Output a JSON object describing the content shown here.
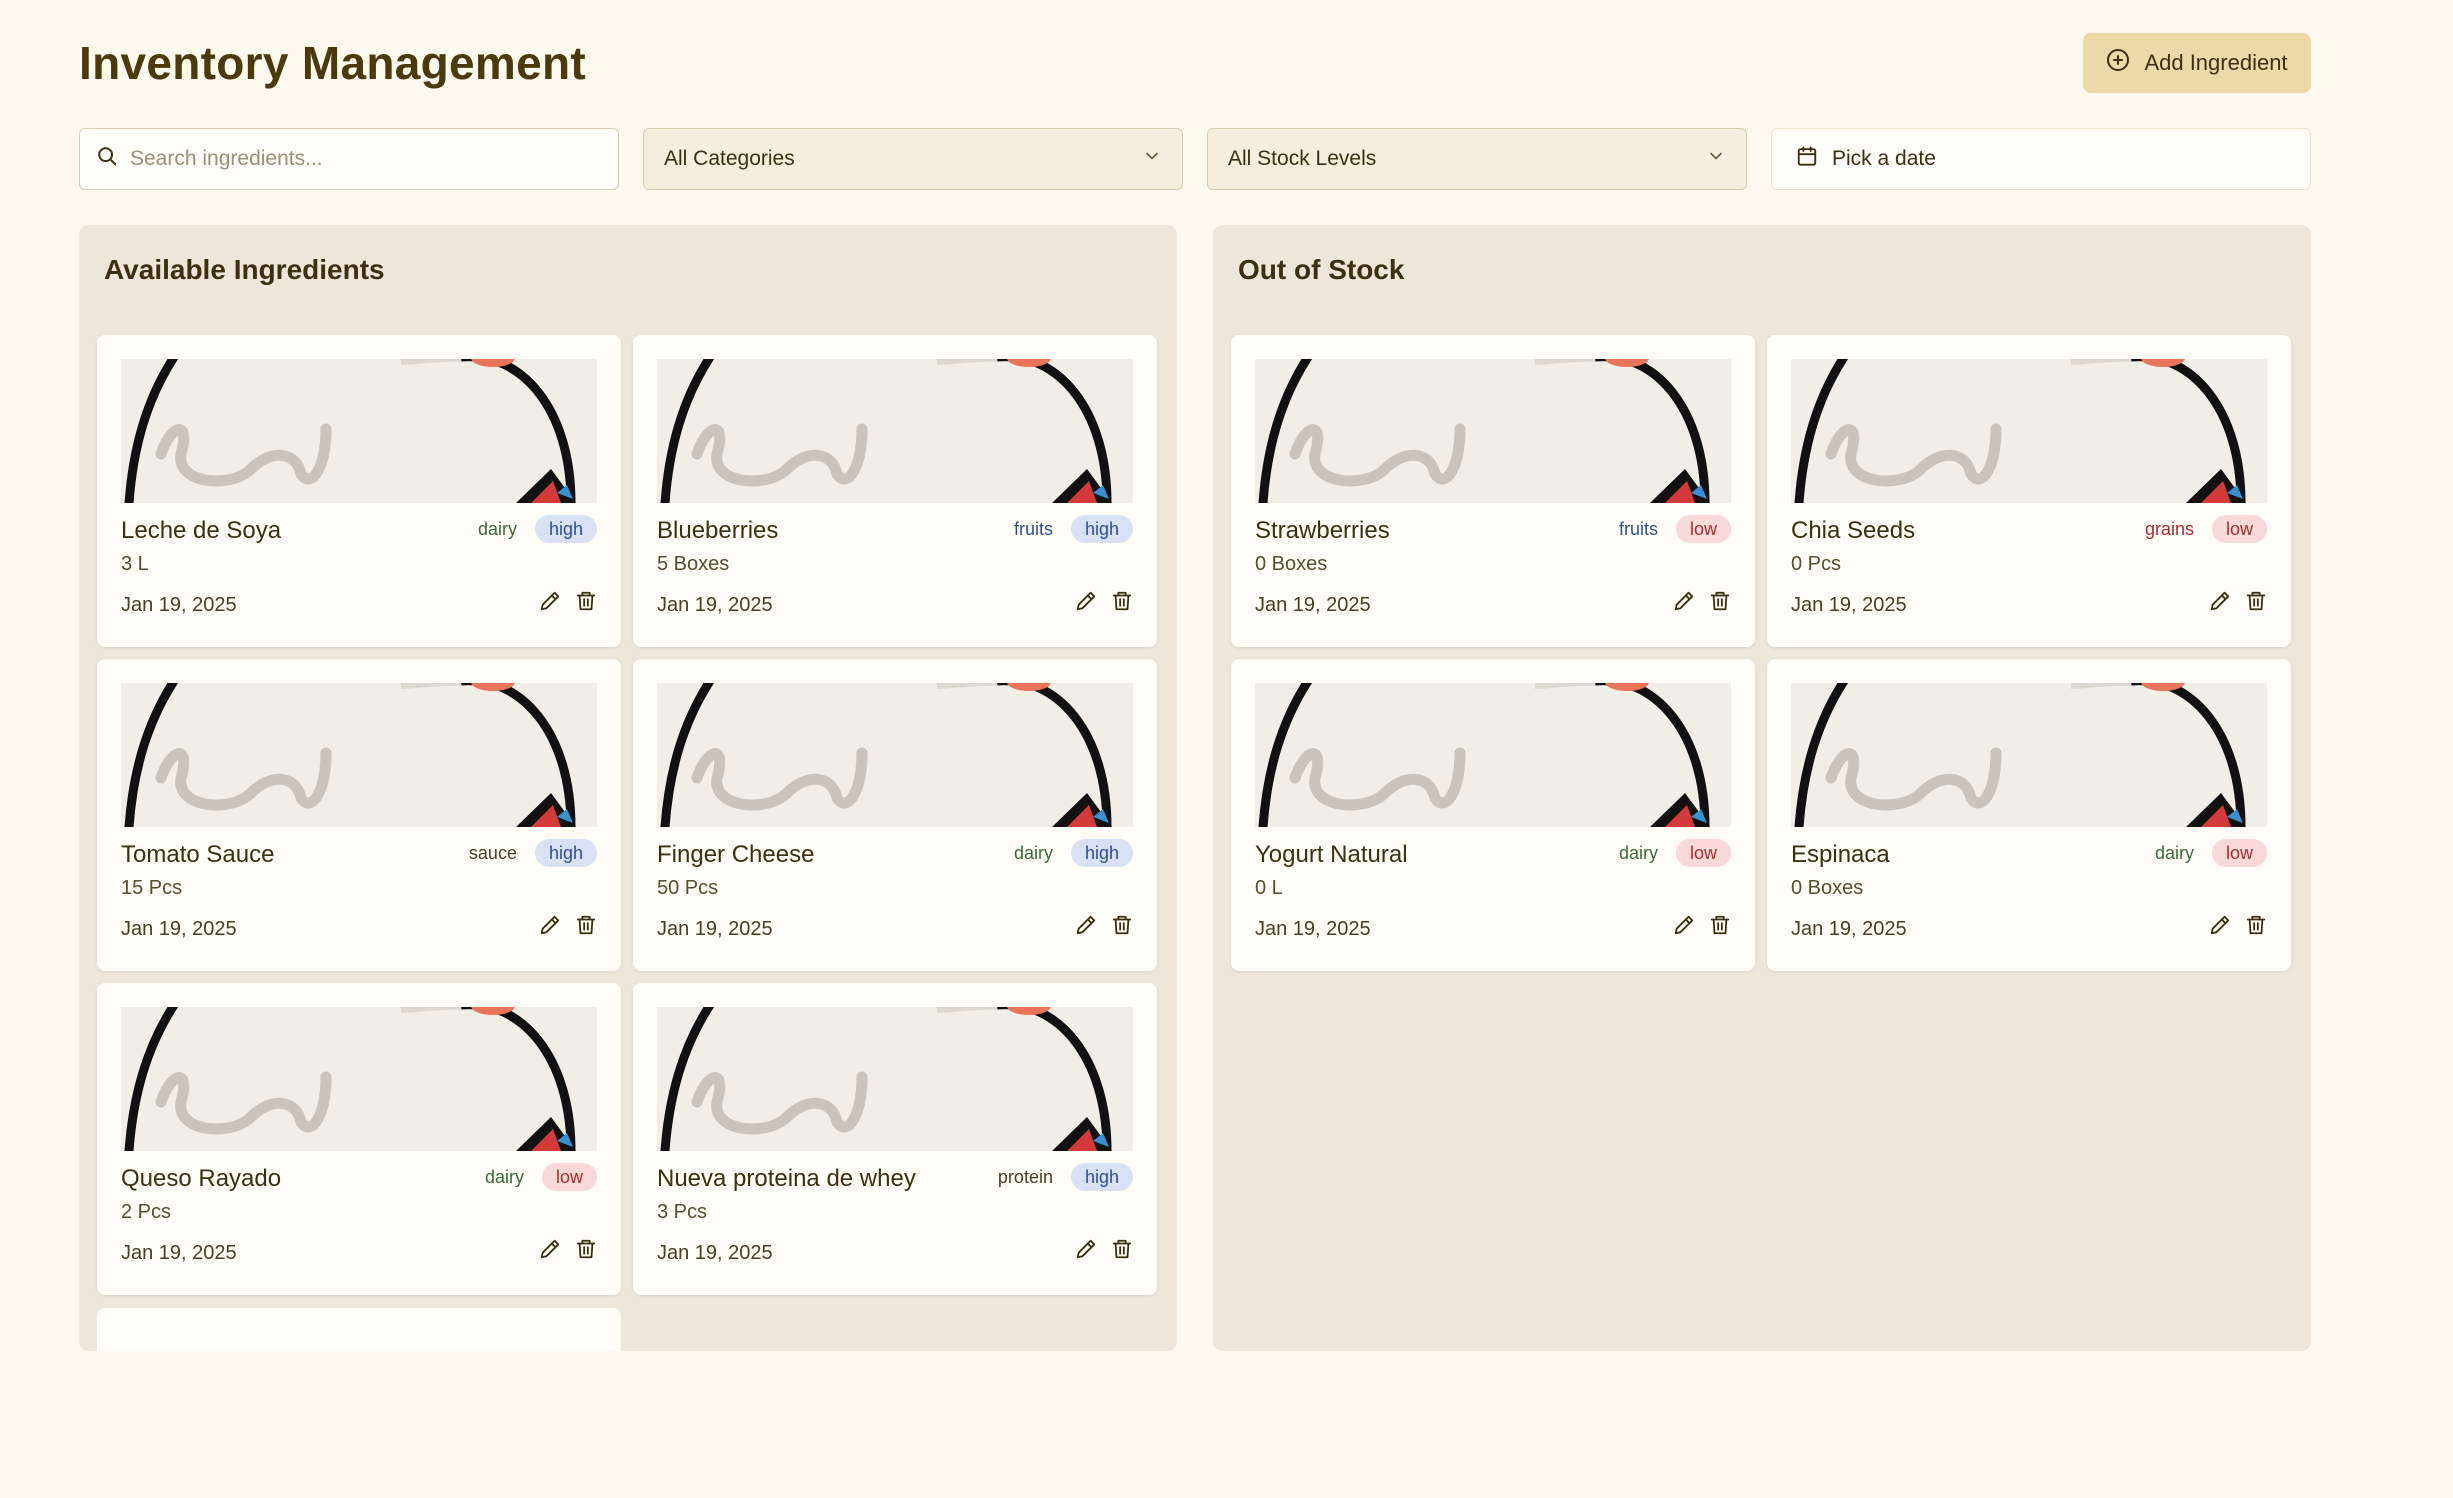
{
  "page": {
    "title": "Inventory Management",
    "add_button_label": "Add Ingredient"
  },
  "filters": {
    "search_placeholder": "Search ingredients...",
    "category_value": "All Categories",
    "stock_value": "All Stock Levels",
    "date_placeholder": "Pick a date"
  },
  "available": {
    "title": "Available Ingredients",
    "items": [
      {
        "name": "Leche de Soya",
        "qty": "3 L",
        "date": "Jan 19, 2025",
        "category": "dairy",
        "level": "high"
      },
      {
        "name": "Blueberries",
        "qty": "5 Boxes",
        "date": "Jan 19, 2025",
        "category": "fruits",
        "level": "high"
      },
      {
        "name": "Tomato Sauce",
        "qty": "15 Pcs",
        "date": "Jan 19, 2025",
        "category": "sauce",
        "level": "high"
      },
      {
        "name": "Finger Cheese",
        "qty": "50 Pcs",
        "date": "Jan 19, 2025",
        "category": "dairy",
        "level": "high"
      },
      {
        "name": "Queso Rayado",
        "qty": "2 Pcs",
        "date": "Jan 19, 2025",
        "category": "dairy",
        "level": "low"
      },
      {
        "name": "Nueva proteina de whey",
        "qty": "3 Pcs",
        "date": "Jan 19, 2025",
        "category": "protein",
        "level": "high"
      }
    ]
  },
  "out_of_stock": {
    "title": "Out of Stock",
    "items": [
      {
        "name": "Strawberries",
        "qty": "0 Boxes",
        "date": "Jan 19, 2025",
        "category": "fruits",
        "level": "low"
      },
      {
        "name": "Chia Seeds",
        "qty": "0 Pcs",
        "date": "Jan 19, 2025",
        "category": "grains",
        "level": "low"
      },
      {
        "name": "Yogurt Natural",
        "qty": "0 L",
        "date": "Jan 19, 2025",
        "category": "dairy",
        "level": "low"
      },
      {
        "name": "Espinaca",
        "qty": "0 Boxes",
        "date": "Jan 19, 2025",
        "category": "dairy",
        "level": "low"
      }
    ]
  },
  "icons": {
    "add": "plus-circle-icon",
    "search": "search-icon",
    "chevron": "chevron-down-icon",
    "calendar": "calendar-icon",
    "edit": "pencil-icon",
    "delete": "trash-icon"
  },
  "colors": {
    "background": "#fdf9ee",
    "accent_button": "#ecd9a8",
    "panel": "#ede6d9",
    "high_badge": "#d8e2f4",
    "low_badge": "#f8d9d7"
  }
}
